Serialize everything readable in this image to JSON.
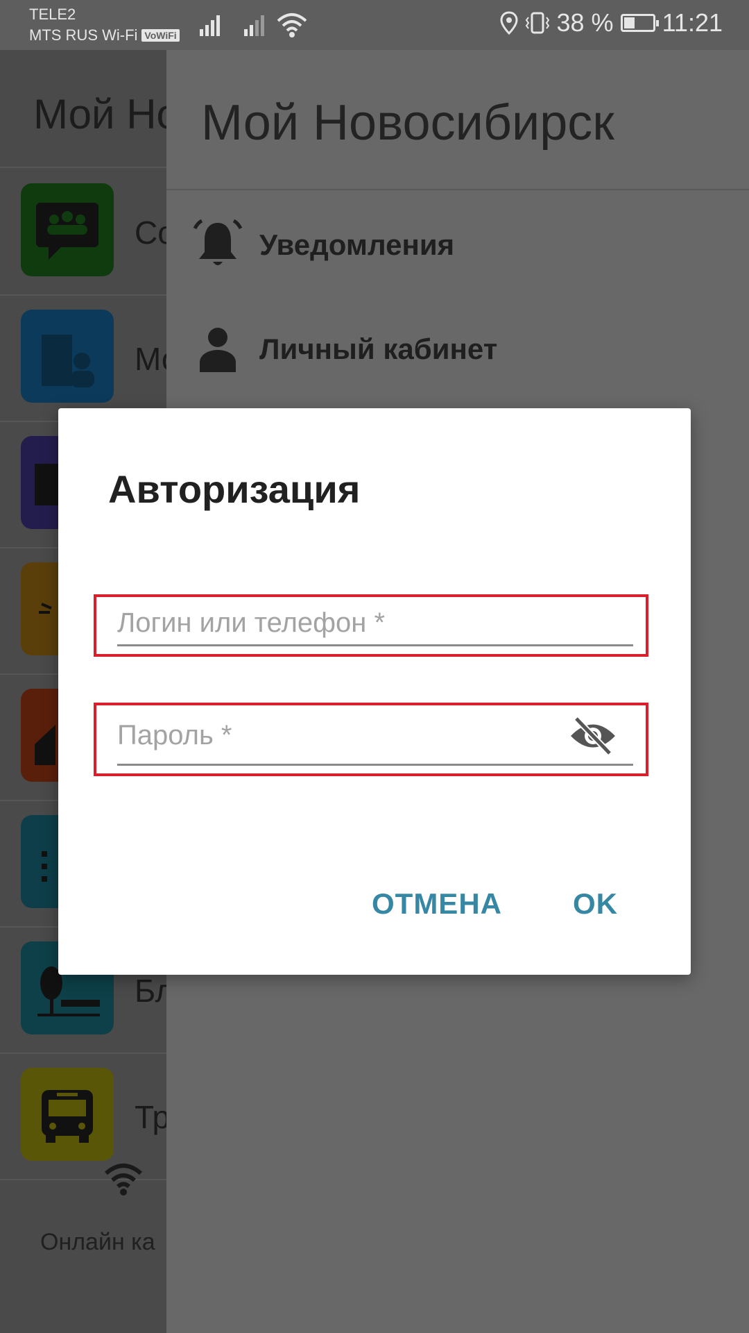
{
  "status_bar": {
    "operator1": "TELE2",
    "operator2": "MTS RUS Wi-Fi",
    "vowifi": "VoWiFi",
    "battery": "38 %",
    "battery_level": 0.38,
    "time": "11:21"
  },
  "app": {
    "title": "Мой Но",
    "menu_items": [
      {
        "label": "Со",
        "color": "#0f3b0f",
        "icon": "chat-group-icon"
      },
      {
        "label": "Мо",
        "color": "#0c3a5a",
        "icon": "building-person-icon"
      },
      {
        "label": "",
        "color": "#231d4d",
        "icon": "calendar-icon"
      },
      {
        "label": "",
        "color": "#5a3f0b",
        "icon": "sun-icon"
      },
      {
        "label": "",
        "color": "#5a1f0b",
        "icon": "house-icon"
      },
      {
        "label": "",
        "color": "#0d3e49",
        "icon": "office-building-icon"
      },
      {
        "label": "Бл",
        "color": "#0d4048",
        "icon": "park-bench-icon"
      },
      {
        "label": "Тр",
        "color": "#5a5607",
        "icon": "bus-icon"
      }
    ],
    "bottom_label": "Онлайн ка"
  },
  "drawer": {
    "title": "Мой Новосибирск",
    "items": [
      {
        "label": "Уведомления",
        "icon": "bell-icon"
      },
      {
        "label": "Личный кабинет",
        "icon": "person-icon"
      }
    ]
  },
  "dialog": {
    "title": "Авторизация",
    "login_placeholder": "Логин или телефон *",
    "password_placeholder": "Пароль *",
    "password_toggle_icon": "eye-off-icon",
    "cancel_label": "ОТМЕНА",
    "ok_label": "OK",
    "accent_color": "#3587a4",
    "highlight_color": "#d9202a"
  }
}
